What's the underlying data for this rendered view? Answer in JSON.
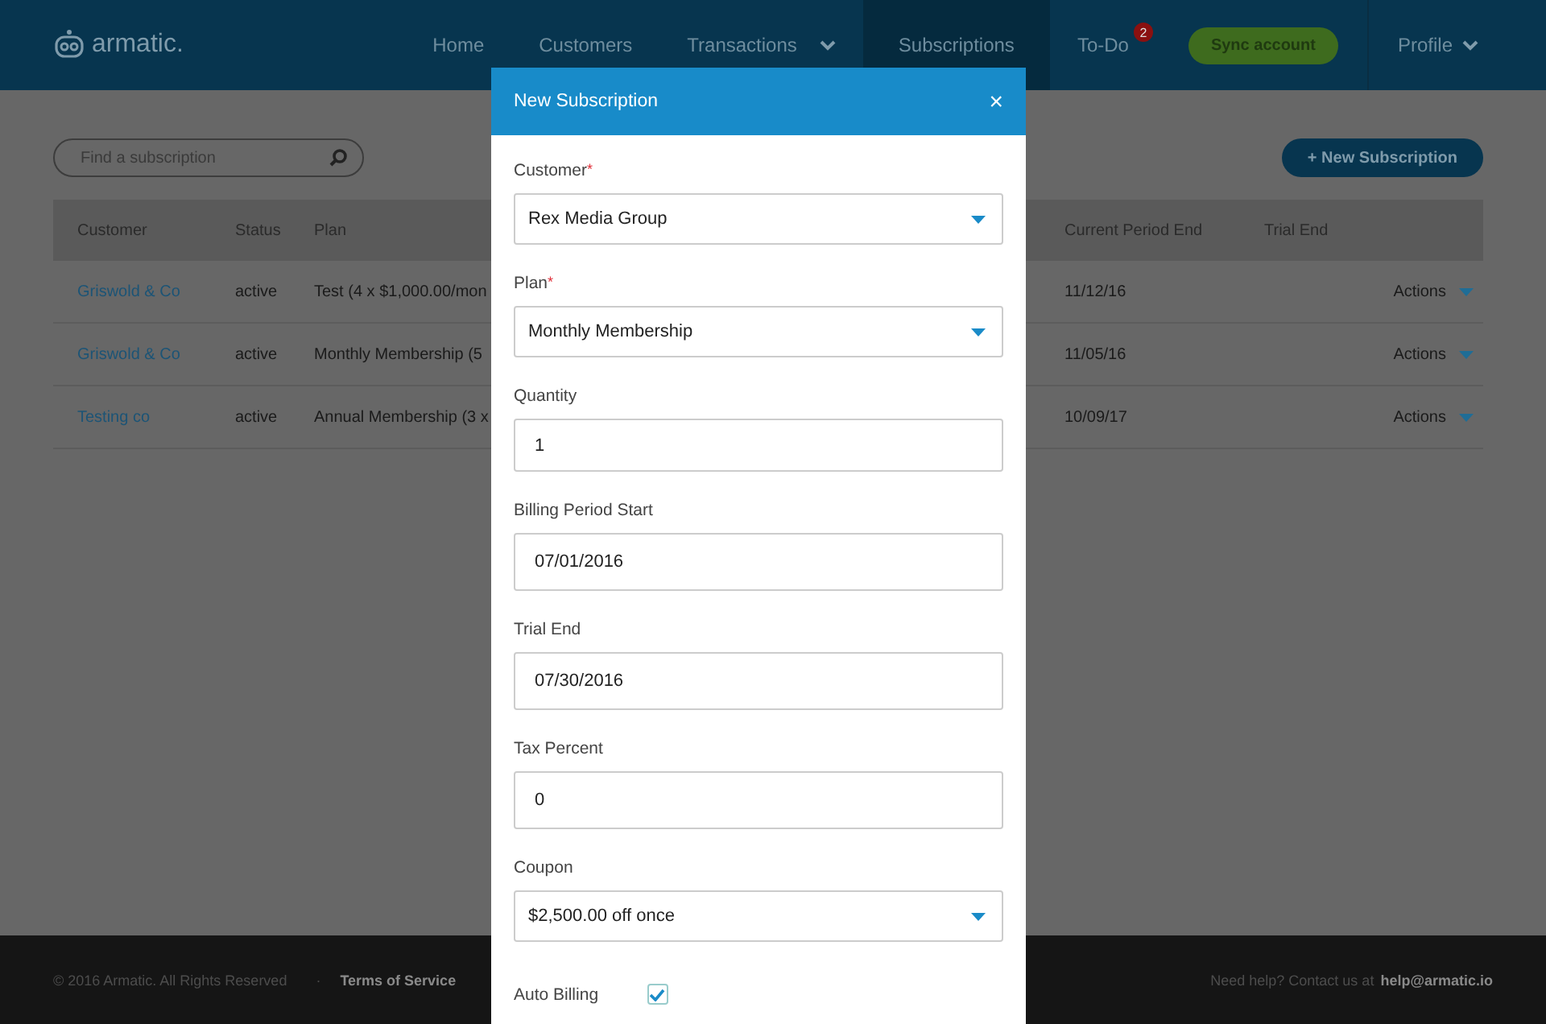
{
  "brand": {
    "name": "armatic."
  },
  "nav": [
    {
      "label": "Home",
      "selected": false,
      "dropdown": false
    },
    {
      "label": "Customers",
      "selected": false,
      "dropdown": false
    },
    {
      "label": "Transactions",
      "selected": false,
      "dropdown": true
    },
    {
      "label": "Subscriptions",
      "selected": true,
      "dropdown": false
    },
    {
      "label": "To-Do",
      "selected": false,
      "dropdown": false,
      "badge": "2"
    }
  ],
  "sync_button": "Sync account",
  "profile": {
    "label": "Profile"
  },
  "search": {
    "placeholder": "Find a subscription"
  },
  "new_button": "+ New Subscription",
  "table": {
    "columns": [
      "Customer",
      "Status",
      "Plan",
      "Current Period End",
      "Trial End"
    ],
    "rows": [
      {
        "customer": "Griswold & Co",
        "status": "active",
        "plan": "Test (4 x $1,000.00/mon",
        "period_end": "11/12/16",
        "trial_end": "",
        "actions": "Actions"
      },
      {
        "customer": "Griswold & Co",
        "status": "active",
        "plan": "Monthly Membership (5",
        "period_end": "11/05/16",
        "trial_end": "",
        "actions": "Actions"
      },
      {
        "customer": "Testing co",
        "status": "active",
        "plan": "Annual Membership (3 x",
        "period_end": "10/09/17",
        "trial_end": "",
        "actions": "Actions"
      }
    ]
  },
  "footer": {
    "copyright": "© 2016 Armatic. All Rights Reserved",
    "separator": "·",
    "terms": "Terms of Service",
    "help": "Need help? Contact us at",
    "email": "help@armatic.io"
  },
  "modal": {
    "title": "New Subscription",
    "close": "×",
    "fields": [
      {
        "kind": "select",
        "label": "Customer",
        "required_mark": "*",
        "value": "Rex Media Group"
      },
      {
        "kind": "select",
        "label": "Plan",
        "required_mark": "*",
        "value": "Monthly Membership"
      },
      {
        "kind": "input",
        "label": "Quantity",
        "value": "1"
      },
      {
        "kind": "input",
        "label": "Billing Period Start",
        "value": "07/01/2016"
      },
      {
        "kind": "input",
        "label": "Trial End",
        "value": "07/30/2016"
      },
      {
        "kind": "input",
        "label": "Tax Percent",
        "value": "0"
      },
      {
        "kind": "select",
        "label": "Coupon",
        "value": "$2,500.00 off once"
      },
      {
        "kind": "checkbox",
        "label": "Auto Billing",
        "checked": true
      }
    ]
  }
}
